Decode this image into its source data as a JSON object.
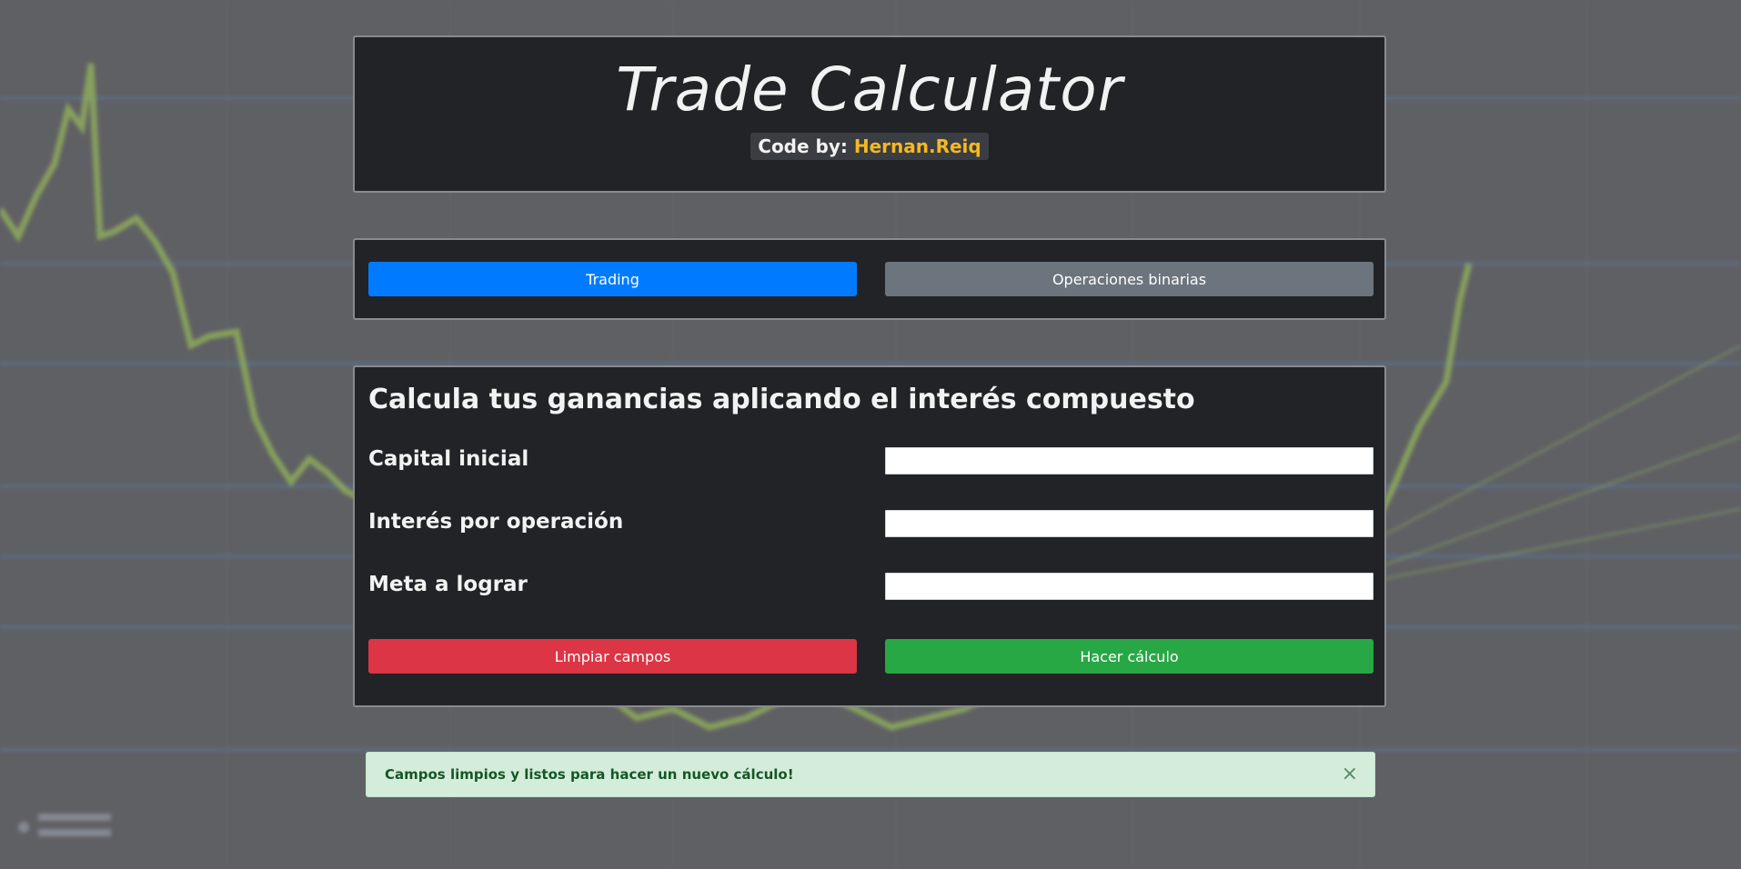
{
  "header": {
    "title": "Trade Calculator",
    "credit_prefix": "Code by:",
    "credit_author": "Hernan.Reiq"
  },
  "modes": {
    "trading_label": "Trading",
    "binary_label": "Operaciones binarias"
  },
  "calculator": {
    "heading": "Calcula tus ganancias aplicando el interés compuesto",
    "fields": [
      {
        "label": "Capital inicial",
        "value": "",
        "placeholder": ""
      },
      {
        "label": "Interés por operación",
        "value": "",
        "placeholder": ""
      },
      {
        "label": "Meta a lograr",
        "value": "",
        "placeholder": ""
      }
    ],
    "clear_label": "Limpiar campos",
    "calculate_label": "Hacer cálculo"
  },
  "alert": {
    "message": "Campos limpios y listos para hacer un nuevo cálculo!",
    "close_symbol": "×"
  },
  "colors": {
    "primary": "#007bff",
    "secondary": "#6c757d",
    "danger": "#dc3545",
    "success": "#28a745",
    "accent_author": "#f5b921",
    "alert_bg": "#d4edda"
  }
}
